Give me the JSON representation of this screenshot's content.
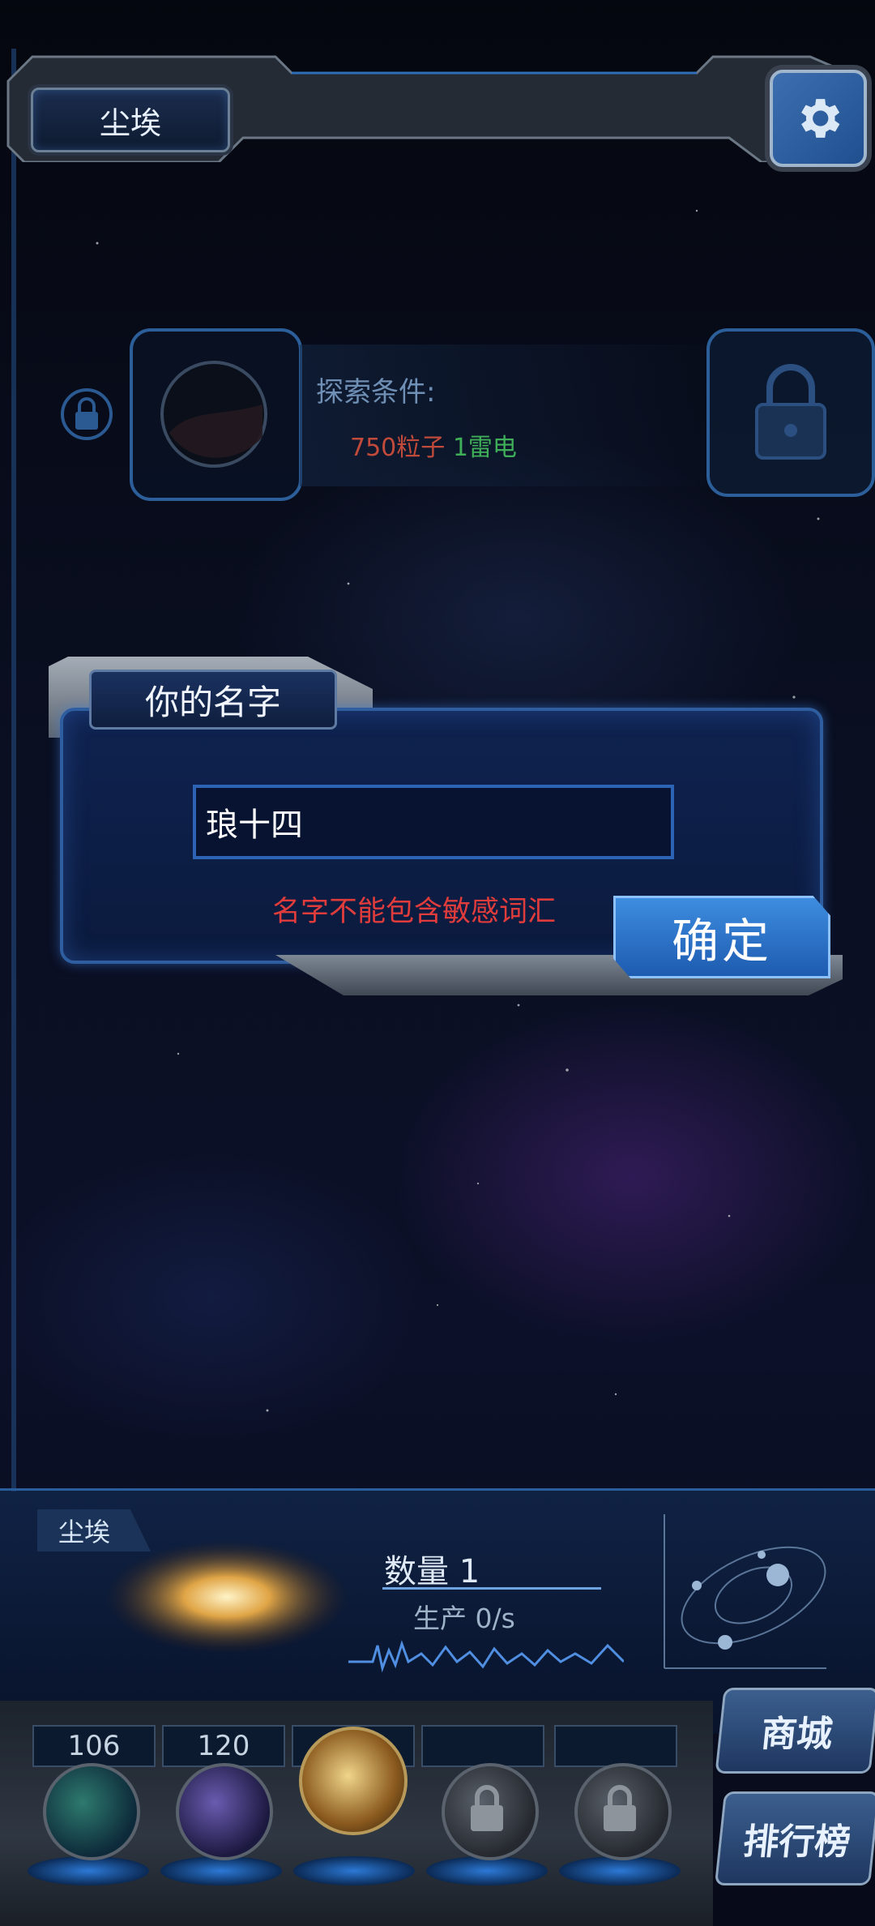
{
  "header": {
    "title": "尘埃"
  },
  "explore": {
    "label": "探索条件:",
    "cost_particles": "750粒子",
    "cost_thunder": "1雷电"
  },
  "dialog": {
    "title": "你的名字",
    "input_value": "琅十四",
    "warning": "名字不能包含敏感词汇",
    "confirm_label": "确定"
  },
  "bottom": {
    "element_tag": "尘埃",
    "quantity": "数量 1",
    "production": "生产 0/s",
    "slots": [
      {
        "count": "106",
        "icon": "atom-orb-icon",
        "locked": false
      },
      {
        "count": "120",
        "icon": "lightning-orb-icon",
        "locked": false
      },
      {
        "count": "",
        "icon": "dust-orb-icon",
        "locked": false,
        "selected": true
      },
      {
        "count": "",
        "icon": "lock-orb-icon",
        "locked": true
      },
      {
        "count": "",
        "icon": "lock-orb-icon",
        "locked": true
      }
    ],
    "shop_label": "商城",
    "ranking_label": "排行榜"
  },
  "colors": {
    "accent_blue": "#2f5ea0",
    "warning_red": "#e03c3c",
    "cost_red": "#c24a3a",
    "cost_green": "#3fae58"
  }
}
